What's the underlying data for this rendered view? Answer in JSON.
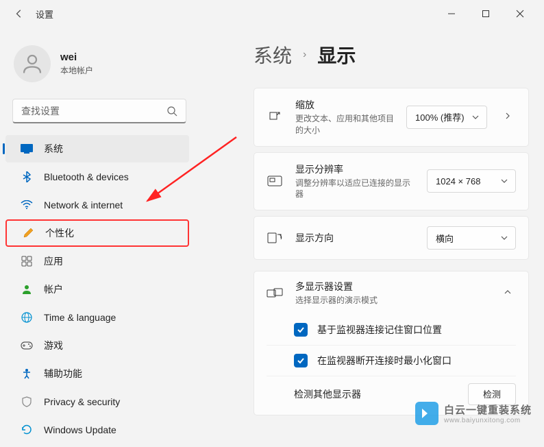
{
  "window": {
    "title": "设置"
  },
  "user": {
    "name": "wei",
    "account_type": "本地帐户"
  },
  "search": {
    "placeholder": "查找设置"
  },
  "sidebar": {
    "items": [
      {
        "label": "系统",
        "active": true
      },
      {
        "label": "Bluetooth & devices"
      },
      {
        "label": "Network & internet"
      },
      {
        "label": "个性化",
        "highlighted": true
      },
      {
        "label": "应用"
      },
      {
        "label": "帐户"
      },
      {
        "label": "Time & language"
      },
      {
        "label": "游戏"
      },
      {
        "label": "辅助功能"
      },
      {
        "label": "Privacy & security"
      },
      {
        "label": "Windows Update"
      }
    ]
  },
  "breadcrumb": {
    "parent": "系统",
    "current": "显示"
  },
  "cards": {
    "scale": {
      "title": "缩放",
      "subtitle": "更改文本、应用和其他项目的大小",
      "value": "100% (推荐)"
    },
    "resolution": {
      "title": "显示分辨率",
      "subtitle": "调整分辨率以适应已连接的显示器",
      "value": "1024 × 768"
    },
    "orientation": {
      "title": "显示方向",
      "value": "横向"
    },
    "multimonitor": {
      "title": "多显示器设置",
      "subtitle": "选择显示器的演示模式",
      "checkbox1": "基于监视器连接记住窗口位置",
      "checkbox2": "在监视器断开连接时最小化窗口",
      "detect_label": "检测其他显示器",
      "detect_button": "检测"
    }
  },
  "watermark": {
    "brand": "白云一键重装系统",
    "url": "www.baiyunxitong.com"
  }
}
